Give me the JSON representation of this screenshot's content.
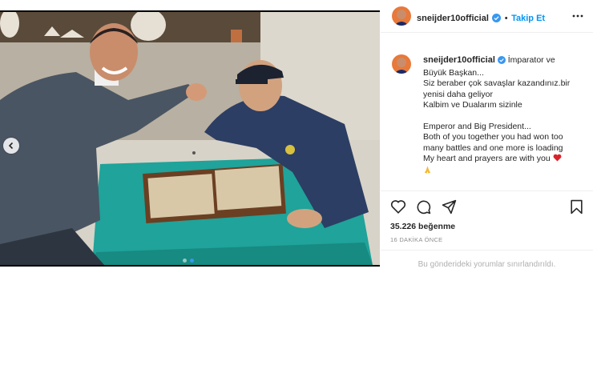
{
  "post": {
    "username": "sneijder10official",
    "follow_label": "Takip Et",
    "caption_lines_tr": [
      "İmparator ve",
      "Büyük Başkan...",
      "Siz beraber çok savaşlar kazandınız.bir",
      "yenisi daha geliyor",
      "Kalbim ve Dualarım sizinle"
    ],
    "caption_lines_en": [
      "Emperor and Big President...",
      "Both of you together you had won too",
      "many battles and one more is loading",
      "My heart and prayers are with you"
    ],
    "likes_label": "35.226 beğenme",
    "time_label": "16 DAKİKA ÖNCE",
    "comments_notice": "Bu gönderideki yorumlar sınırlandırıldı."
  },
  "carousel": {
    "current": 2,
    "total": 2
  },
  "icons": {
    "prev": "chevron-left-icon",
    "verified": "verified-badge-icon",
    "more": "more-options-icon",
    "like": "heart-icon",
    "comment": "comment-icon",
    "share": "send-icon",
    "save": "bookmark-icon",
    "emoji_heart": "red-heart-emoji",
    "emoji_pray": "praying-hands-emoji"
  },
  "colors": {
    "accent": "#0095f6",
    "table": "#1fa39a",
    "text": "#262626",
    "muted": "#8e8e8e"
  }
}
